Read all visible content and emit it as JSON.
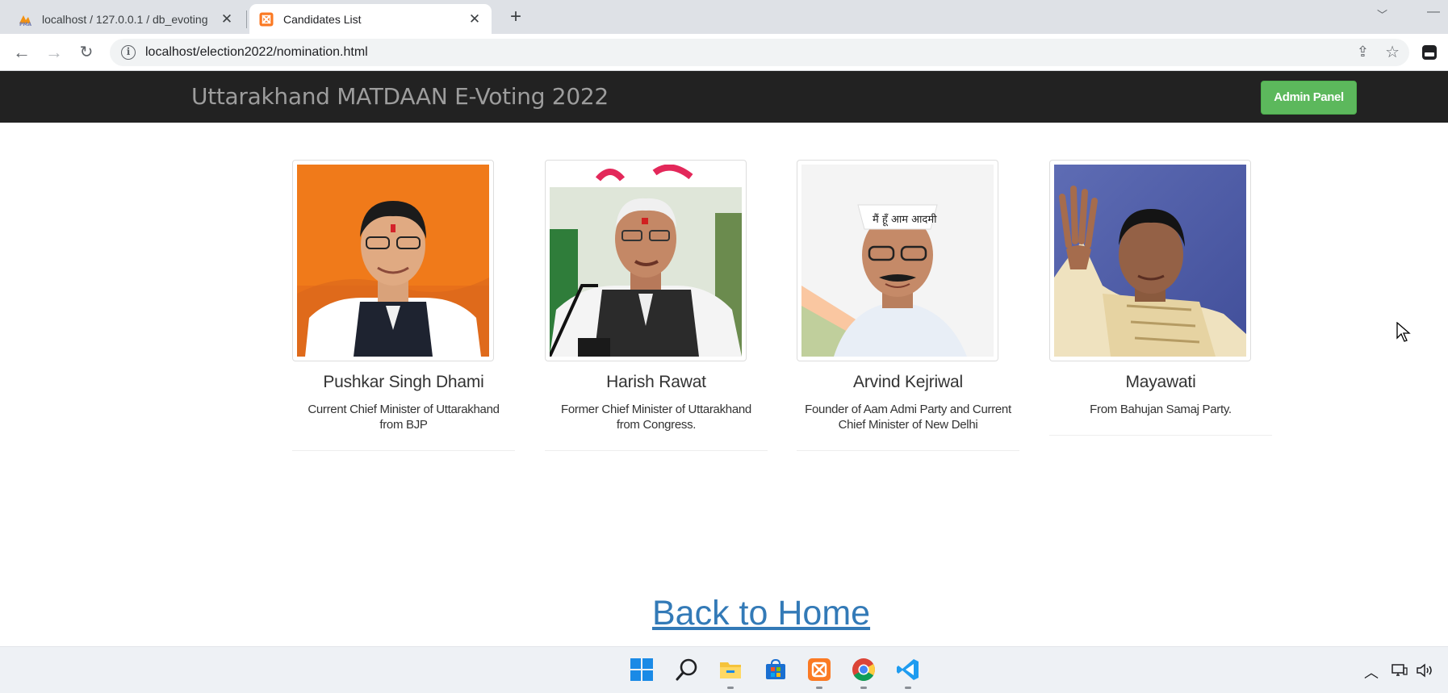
{
  "browser": {
    "tabs": [
      {
        "title": "localhost / 127.0.0.1 / db_evoting",
        "active": false
      },
      {
        "title": "Candidates List",
        "active": true
      }
    ],
    "url": "localhost/election2022/nomination.html"
  },
  "navbar": {
    "brand": "Uttarakhand MATDAAN E-Voting 2022",
    "admin_button": "Admin Panel",
    "accent": "#5cb85c"
  },
  "candidates": [
    {
      "name": "Pushkar Singh Dhami",
      "description": "Current Chief Minister of Uttarakhand from BJP",
      "photo_background": "#f07a1a"
    },
    {
      "name": "Harish Rawat",
      "description": "Former Chief Minister of Uttarakhand from Congress.",
      "photo_background": "#d9e3d3"
    },
    {
      "name": "Arvind Kejriwal",
      "description": "Founder of Aam Admi Party and Current Chief Minister of New Delhi",
      "photo_background": "#f4f4f4"
    },
    {
      "name": "Mayawati",
      "description": "From Bahujan Samaj Party.",
      "photo_background": "#4b5aa8"
    }
  ],
  "photo_captions": {
    "banner_text": "मैं हूँ आम आदमी"
  },
  "footer": {
    "back_link": "Back to Home"
  },
  "taskbar": {
    "icons": [
      "windows-start-icon",
      "search-icon",
      "file-explorer-icon",
      "microsoft-store-icon",
      "xampp-icon",
      "chrome-icon",
      "vscode-icon"
    ]
  }
}
